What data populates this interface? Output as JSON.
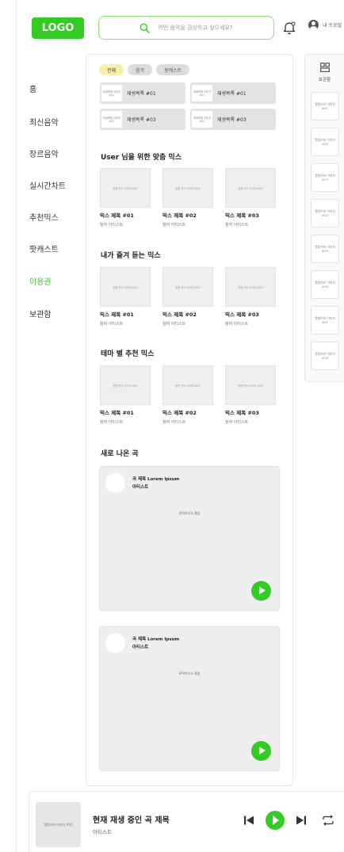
{
  "header": {
    "logo": "LOGO",
    "search_placeholder": "어떤 음악을 감상하고 싶으세요?",
    "profile_label": "내 프로필"
  },
  "nav": {
    "items": [
      {
        "label": "홈"
      },
      {
        "label": "최신음악"
      },
      {
        "label": "장르음악"
      },
      {
        "label": "실시간차트"
      },
      {
        "label": "추천믹스"
      },
      {
        "label": "팟캐스트"
      },
      {
        "label": "이용권",
        "active": true
      },
      {
        "label": "보관함"
      }
    ]
  },
  "filters": {
    "chips": [
      {
        "label": "전체",
        "selected": true
      },
      {
        "label": "음악"
      },
      {
        "label": "팟캐스트"
      }
    ]
  },
  "recent": [
    {
      "thumb": "재생목록 이미지 #01",
      "label": "재생목록 #01"
    },
    {
      "thumb": "재생목록 이미지 #01",
      "label": "재생목록 #01"
    },
    {
      "thumb": "재생목록 이미지 #03",
      "label": "재생목록 #03"
    },
    {
      "thumb": "재생목록 이미지 #03",
      "label": "재생목록 #03"
    }
  ],
  "sections": [
    {
      "title": "User 님을 위한 맞춤 믹스",
      "items": [
        {
          "thumb": "맞춤 믹스 이미지 #01",
          "title": "믹스 제목 #01",
          "artist": "참여 아티스트"
        },
        {
          "thumb": "맞춤 믹스 이미지 #02",
          "title": "믹스 제목 #02",
          "artist": "참여 아티스트"
        },
        {
          "thumb": "맞춤 믹스 이미지 #03",
          "title": "믹스 제목 #03",
          "artist": "참여 아티스트"
        }
      ]
    },
    {
      "title": "내가 즐겨 듣는 믹스",
      "items": [
        {
          "thumb": "맞춤 믹스 이미지 #01",
          "title": "믹스 제목 #01",
          "artist": "참여 아티스트"
        },
        {
          "thumb": "맞춤 믹스 이미지 #02",
          "title": "믹스 제목 #02",
          "artist": "참여 아티스트"
        },
        {
          "thumb": "맞춤 믹스 이미지 #03",
          "title": "믹스 제목 #03",
          "artist": "참여 아티스트"
        }
      ]
    },
    {
      "title": "테마 별 추천 믹스",
      "items": [
        {
          "thumb": "맞춤 믹스 이미지 #01",
          "title": "믹스 제목 #01",
          "artist": "참여 아티스트"
        },
        {
          "thumb": "맞춤 믹스 이미지 #02",
          "title": "믹스 제목 #02",
          "artist": "참여 아티스트"
        },
        {
          "thumb": "맞춤 믹스 이미지 #03",
          "title": "믹스 제목 #03",
          "artist": "참여 아티스트"
        }
      ]
    }
  ],
  "new_songs": {
    "title": "새로 나온 곡",
    "items": [
      {
        "title": "곡 제목 Lorem Ipsum",
        "artist": "아티스트",
        "video": "뮤직비디오 클립"
      },
      {
        "title": "곡 제목 Lorem Ipsum",
        "artist": "아티스트",
        "video": "뮤직비디오 클립"
      }
    ]
  },
  "library": {
    "label": "보관함",
    "albums": [
      "앨범커버 이미지 #01",
      "앨범커버 이미지 #02",
      "앨범커버 이미지 #03",
      "앨범커버 이미지 #04",
      "앨범커버 이미지 #05",
      "앨범커버 이미지 #06",
      "앨범커버 이미지 #07",
      "앨범커버 이미지 #08"
    ]
  },
  "player": {
    "cover": "앨범커버 이미지 #01",
    "title": "현재 재생 중인 곡 제목",
    "artist": "아티스트"
  },
  "colors": {
    "accent": "#33cc22",
    "chip_selected": "#f6f0a8",
    "chip": "#dcdcdc"
  }
}
